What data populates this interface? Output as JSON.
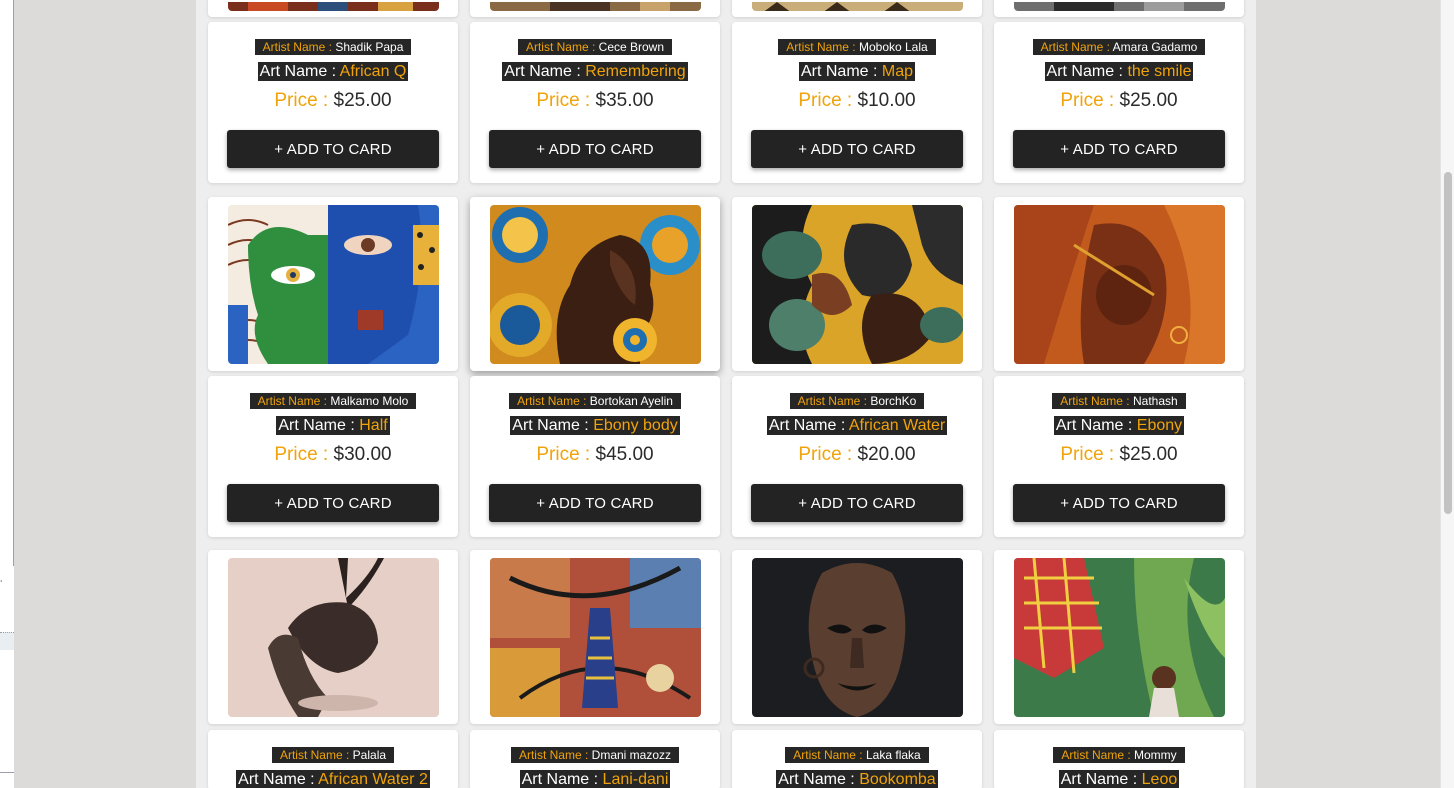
{
  "labels": {
    "artist_prefix": "Artist Name :",
    "art_prefix": "Art Name :",
    "price_prefix": "Price :",
    "add_button": "+ ADD TO CARD"
  },
  "cards": [
    {
      "artist": "Shadik Papa",
      "art": "African Q",
      "price": "$25.00"
    },
    {
      "artist": "Cece Brown",
      "art": "Remembering",
      "price": "$35.00"
    },
    {
      "artist": "Moboko Lala",
      "art": "Map",
      "price": "$10.00"
    },
    {
      "artist": "Amara Gadamo",
      "art": "the smile",
      "price": "$25.00"
    },
    {
      "artist": "Malkamo Molo",
      "art": "Half",
      "price": "$30.00"
    },
    {
      "artist": "Bortokan Ayelin",
      "art": "Ebony body",
      "price": "$45.00"
    },
    {
      "artist": "BorchKo",
      "art": "African Water",
      "price": "$20.00"
    },
    {
      "artist": "Nathash",
      "art": "Ebony",
      "price": "$25.00"
    },
    {
      "artist": "Palala",
      "art": "African Water 2",
      "price": ""
    },
    {
      "artist": "Dmani mazozz",
      "art": "Lani-dani",
      "price": ""
    },
    {
      "artist": "Laka flaka",
      "art": "Bookomba",
      "price": ""
    },
    {
      "artist": "Mommy",
      "art": "Leoo",
      "price": ""
    }
  ],
  "colors": {
    "accent": "#f0a30a",
    "dark": "#262626",
    "button": "#232323"
  }
}
